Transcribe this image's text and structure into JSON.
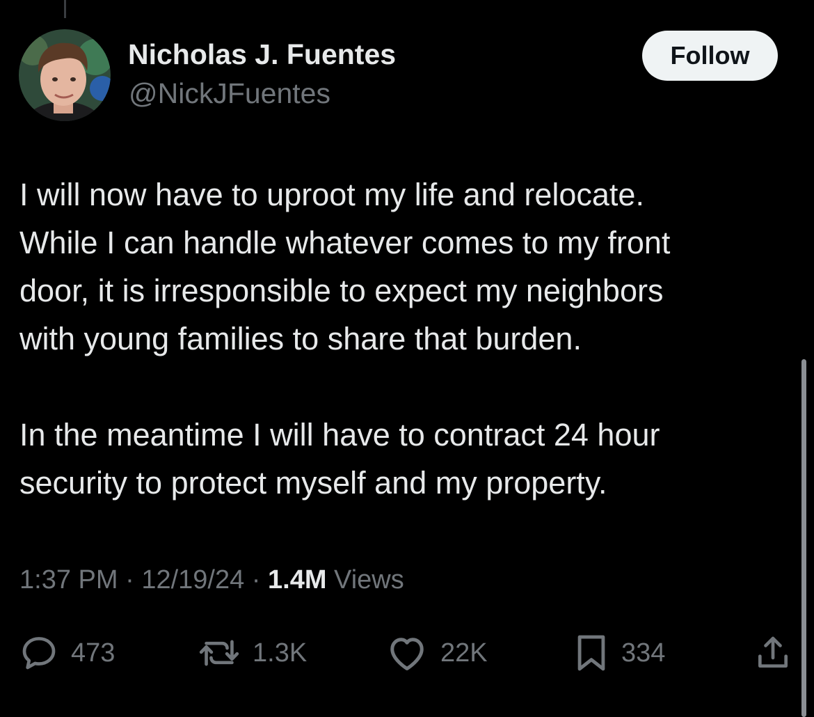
{
  "author": {
    "name": "Nicholas J. Fuentes",
    "handle": "@NickJFuentes",
    "avatar_icon": "profile-photo"
  },
  "follow_button": {
    "label": "Follow"
  },
  "tweet": {
    "lines_paragraph_1": [
      "I will now have to uproot my life and relocate.",
      "While I can handle whatever comes to my front",
      "door, it is irresponsible to expect my neighbors",
      "with young families to share that burden."
    ],
    "lines_paragraph_2": [
      "In the meantime I will have to contract 24 hour",
      "security to protect myself and my property."
    ]
  },
  "meta": {
    "time": "1:37 PM",
    "separator": " · ",
    "date": "12/19/24",
    "views_count": "1.4M",
    "views_label": " Views"
  },
  "actions": {
    "replies": {
      "count": "473",
      "icon": "reply-icon"
    },
    "reposts": {
      "count": "1.3K",
      "icon": "repost-icon"
    },
    "likes": {
      "count": "22K",
      "icon": "heart-icon"
    },
    "bookmarks": {
      "count": "334",
      "icon": "bookmark-icon"
    },
    "share": {
      "icon": "share-icon"
    }
  },
  "colors": {
    "background": "#000000",
    "primary_text": "#e7e9ea",
    "secondary_text": "#71767b",
    "follow_button_bg": "#eff3f4"
  }
}
